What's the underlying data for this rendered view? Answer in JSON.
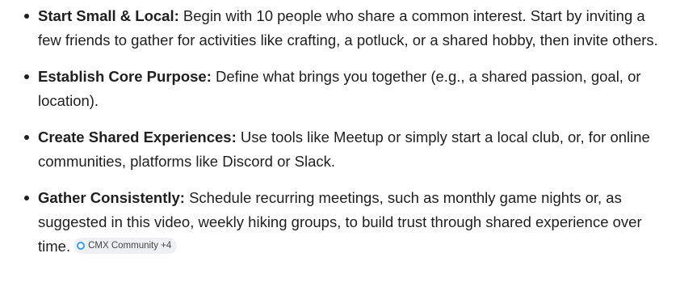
{
  "bullets": [
    {
      "term": "Start Small & Local:",
      "text": "Begin with 10 people who share a common interest. Start by inviting a few friends to gather for activities like crafting, a potluck, or a shared hobby, then invite others."
    },
    {
      "term": "Establish Core Purpose:",
      "text": "Define what brings you together (e.g., a shared passion, goal, or location)."
    },
    {
      "term": "Create Shared Experiences:",
      "text": "Use tools like Meetup or simply start a local club, or, for online communities, platforms like Discord or Slack."
    },
    {
      "term": "Gather Consistently:",
      "text": "Schedule recurring meetings, such as monthly game nights or, as suggested in this video, weekly hiking groups, to build trust through shared experience over time."
    }
  ],
  "source_chip": {
    "label": "CMX Community +4",
    "icon": "source-circle-icon",
    "icon_color": "#3aa0e8"
  }
}
